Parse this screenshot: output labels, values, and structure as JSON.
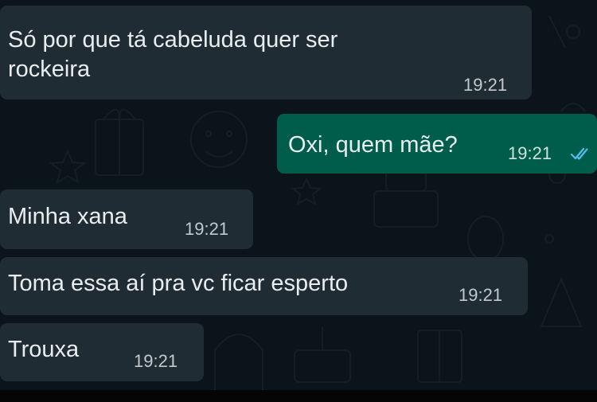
{
  "messages": [
    {
      "direction": "incoming",
      "text_lines": [
        "Só por que tá cabeluda quer ser",
        "rockeira"
      ],
      "time": "19:21"
    },
    {
      "direction": "outgoing",
      "text": "Oxi, quem mãe?",
      "time": "19:21",
      "status": "read",
      "status_icon": "double-check-icon",
      "status_color": "#53bdeb"
    },
    {
      "direction": "incoming",
      "text": "Minha xana",
      "time": "19:21"
    },
    {
      "direction": "incoming",
      "text": "Toma essa aí pra vc ficar esperto",
      "time": "19:21"
    },
    {
      "direction": "incoming",
      "text": "Trouxa",
      "time": "19:21"
    }
  ],
  "colors": {
    "background": "#0b141a",
    "incoming_bubble": "#202c33",
    "outgoing_bubble": "#005c4b",
    "text": "#e9edef"
  }
}
